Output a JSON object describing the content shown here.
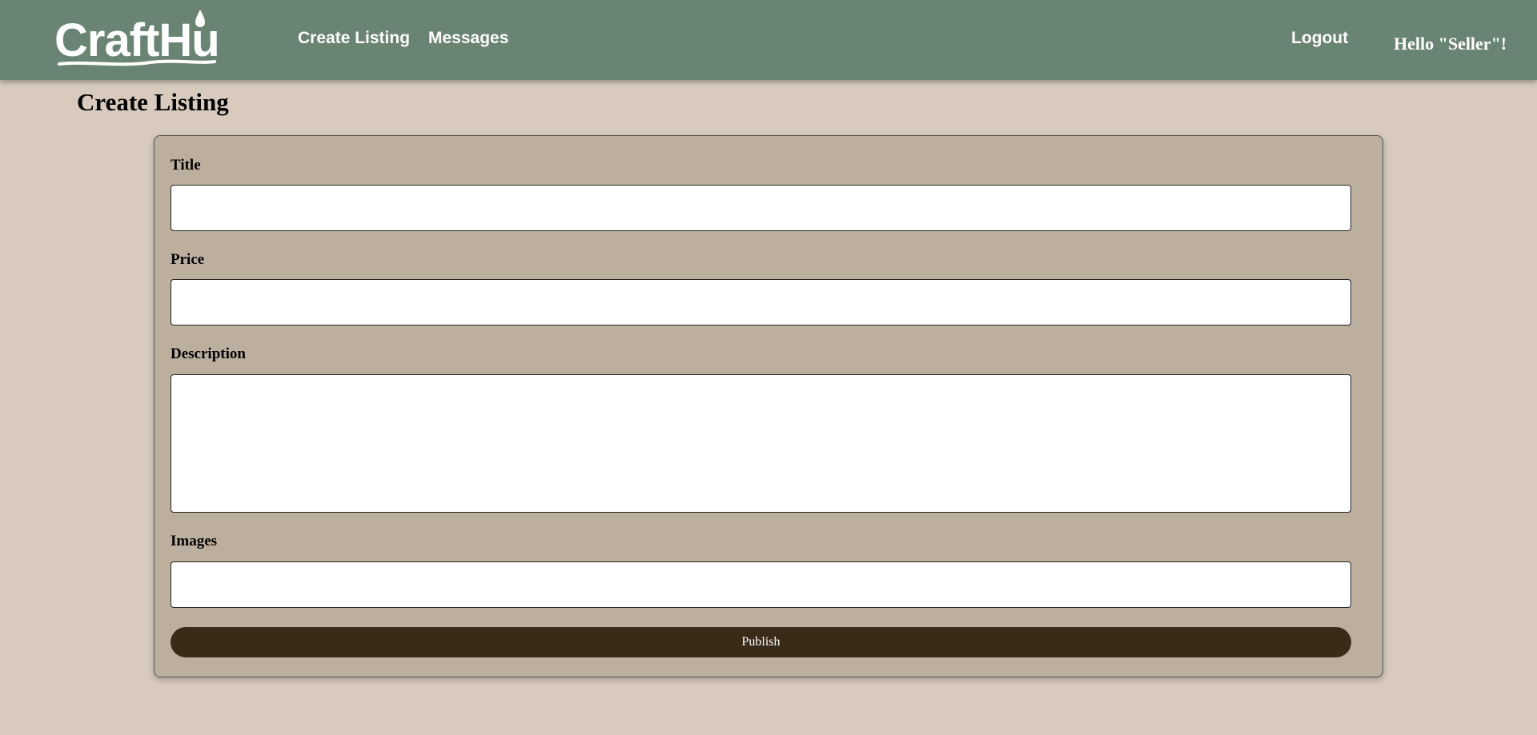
{
  "header": {
    "logo_text": "CraftHub",
    "nav": {
      "create_listing": "Create Listing",
      "messages": "Messages"
    },
    "logout": "Logout",
    "greeting": "Hello \"Seller\"!"
  },
  "main": {
    "page_title": "Create Listing",
    "form": {
      "title_label": "Title",
      "title_value": "",
      "price_label": "Price",
      "price_value": "",
      "description_label": "Description",
      "description_value": "",
      "images_label": "Images",
      "images_value": "",
      "publish_label": "Publish"
    }
  },
  "colors": {
    "navbar": "#6a8473",
    "page_background": "#d8cbbe",
    "form_background": "#bdaf9e",
    "publish_button": "#3a2b19"
  }
}
